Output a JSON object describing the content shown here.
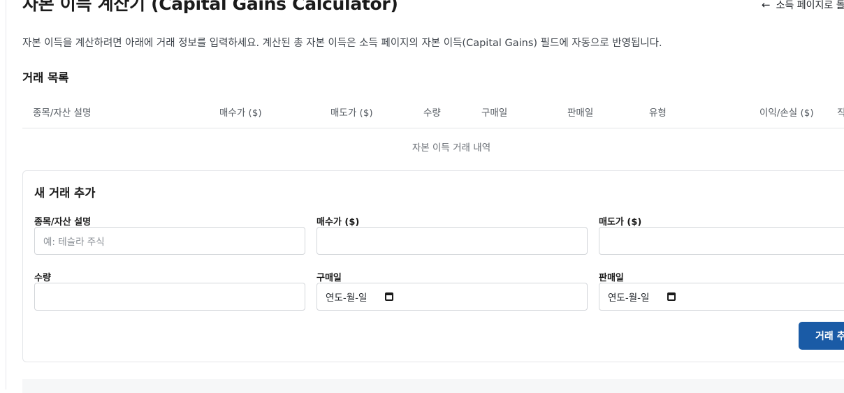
{
  "header": {
    "title": "자본 이득 계산기 (Capital Gains Calculator)",
    "back_link": "소득 페이지로 돌"
  },
  "intro": "자본 이득을 계산하려면 아래에 거래 정보를 입력하세요. 계산된 총 자본 이득은 소득 페이지의 자본 이득(Capital Gains) 필드에 자동으로 반영됩니다.",
  "transactions": {
    "title": "거래 목록",
    "columns": [
      "종목/자산 설명",
      "매수가 ($)",
      "매도가 ($)",
      "수량",
      "구매일",
      "판매일",
      "유형",
      "이익/손실 ($)",
      "직"
    ],
    "empty_text": "자본 이득 거래 내역"
  },
  "form": {
    "title": "새 거래 추가",
    "fields": {
      "description": {
        "label": "종목/자산 설명",
        "placeholder": "예: 테슬라 주식",
        "value": ""
      },
      "buy_price": {
        "label": "매수가 ($)",
        "value": ""
      },
      "sell_price": {
        "label": "매도가 ($)",
        "value": ""
      },
      "quantity": {
        "label": "수량",
        "value": ""
      },
      "buy_date": {
        "label": "구매일",
        "value": "연도-월-일"
      },
      "sell_date": {
        "label": "판매일",
        "value": "연도-월-일"
      }
    },
    "submit_label": "거래 추"
  },
  "icons": {
    "back": "arrow-left-icon",
    "date": "calendar-icon"
  },
  "colors": {
    "primary_button": "#1a5ba6",
    "border": "#d3d6da"
  }
}
